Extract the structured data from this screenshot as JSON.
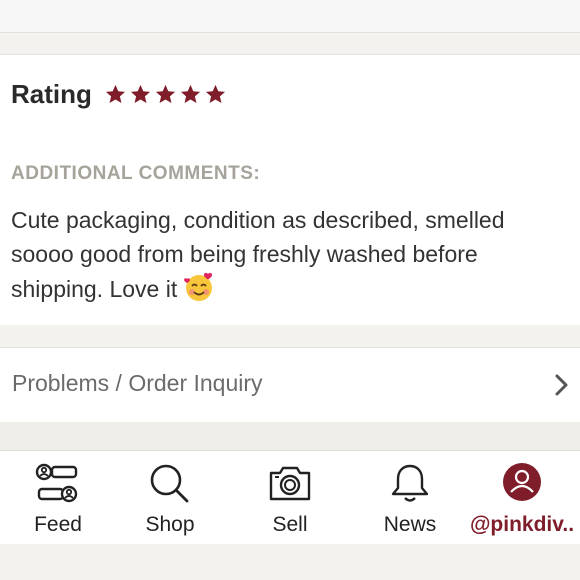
{
  "rating": {
    "label": "Rating",
    "stars": 5,
    "max_stars": 5,
    "star_color": "#7f1d2a"
  },
  "comments": {
    "heading": "ADDITIONAL COMMENTS:",
    "text": "Cute packaging, condition as described, smelled soooo good from being freshly washed before shipping. Love it",
    "emoji": "smiling-face-with-hearts"
  },
  "inquiry": {
    "label": "Problems / Order Inquiry"
  },
  "tabbar": {
    "items": [
      {
        "label": "Feed",
        "icon": "feed-icon"
      },
      {
        "label": "Shop",
        "icon": "search-icon"
      },
      {
        "label": "Sell",
        "icon": "camera-icon"
      },
      {
        "label": "News",
        "icon": "bell-icon"
      },
      {
        "label": "@pinkdiv..",
        "icon": "profile-avatar-icon",
        "active": true
      }
    ],
    "accent_color": "#7f1d2a"
  }
}
